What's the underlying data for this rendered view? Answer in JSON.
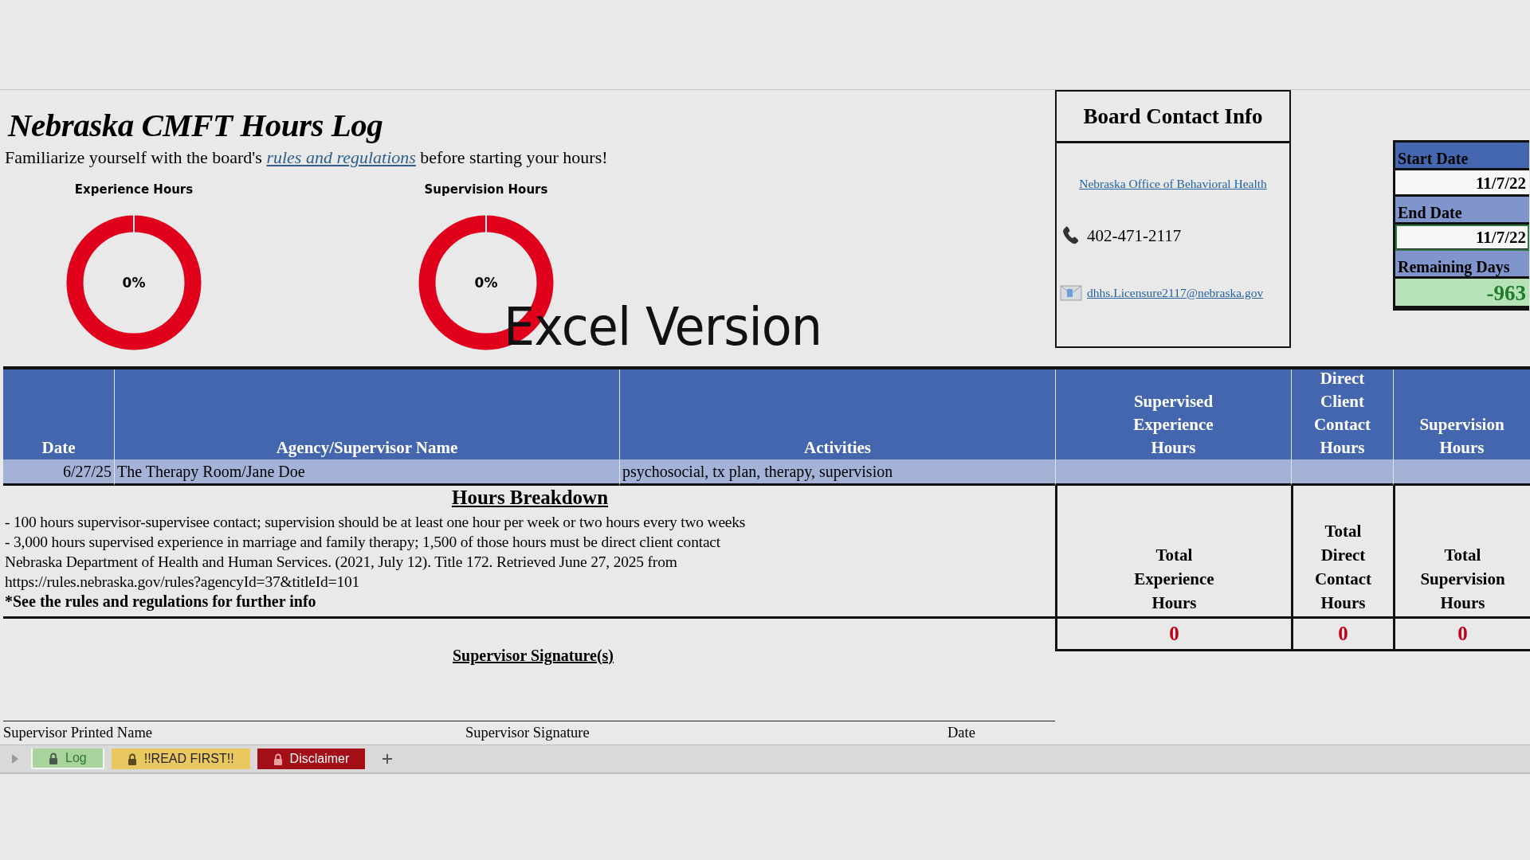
{
  "title": "Nebraska CMFT Hours Log",
  "intro": {
    "before": "Familiarize yourself with the board's",
    "link": "rules and regulations",
    "after": "before starting your hours!"
  },
  "gauges": [
    {
      "label": "Experience Hours",
      "value": "0%"
    },
    {
      "label": "Supervision Hours",
      "value": "0%"
    }
  ],
  "overlay_caption": "Excel Version",
  "board_contact": {
    "title": "Board Contact Info",
    "office_link": "Nebraska Office of Behavioral Health",
    "phone": "402-471-2117",
    "email": "dhhs.Licensure2117@nebraska.gov"
  },
  "date_panel": [
    {
      "kind": "date",
      "label": "Start Date",
      "value": "11/7/22",
      "selected": false
    },
    {
      "kind": "date",
      "label": "End Date",
      "value": "11/7/22",
      "selected": true
    },
    {
      "kind": "remaining",
      "label": "Remaining Days",
      "value": "-963",
      "selected": false
    }
  ],
  "table": {
    "columns": [
      "Date",
      "Agency/Supervisor Name",
      "Activities",
      "Supervised Experience Hours",
      "Direct Client Contact Hours",
      "Supervision Hours"
    ],
    "rows": [
      {
        "date": "6/27/25",
        "agency_supervisor": "The Therapy Room/Jane Doe",
        "activities": "psychosocial, tx plan, therapy, supervision"
      }
    ]
  },
  "hours_breakdown": {
    "title": "Hours Breakdown",
    "lines": [
      "- 100 hours supervisor-supervisee contact; supervision should be at least one hour per week or two hours every two weeks",
      "- 3,000 hours supervised experience in marriage and family therapy; 1,500 of those hours must be direct client contact",
      "Nebraska Department of Health and Human Services. (2021, July 12). Title 172. Retrieved June 27, 2025 from",
      "https://rules.nebraska.gov/rules?agencyId=37&titleId=101"
    ],
    "note": "*See the rules and regulations for further info"
  },
  "totals": [
    {
      "label": "Total Experience Hours",
      "value": "0"
    },
    {
      "label": "Total Direct Contact Hours",
      "value": "0"
    },
    {
      "label": "Total Supervision Hours",
      "value": "0"
    }
  ],
  "signature": {
    "title": "Supervisor Signature(s)",
    "fields": [
      "Supervisor Printed Name",
      "Supervisor Signature",
      "Date"
    ]
  },
  "sheet_tabs": [
    {
      "label": "Log",
      "color": "#a9d39c",
      "selected": true,
      "locked": true
    },
    {
      "label": "!!READ FIRST!!",
      "color": "#e9c95f",
      "selected": false,
      "locked": true
    },
    {
      "label": "Disclaimer",
      "color": "#a40e16",
      "selected": false,
      "locked": true
    }
  ]
}
